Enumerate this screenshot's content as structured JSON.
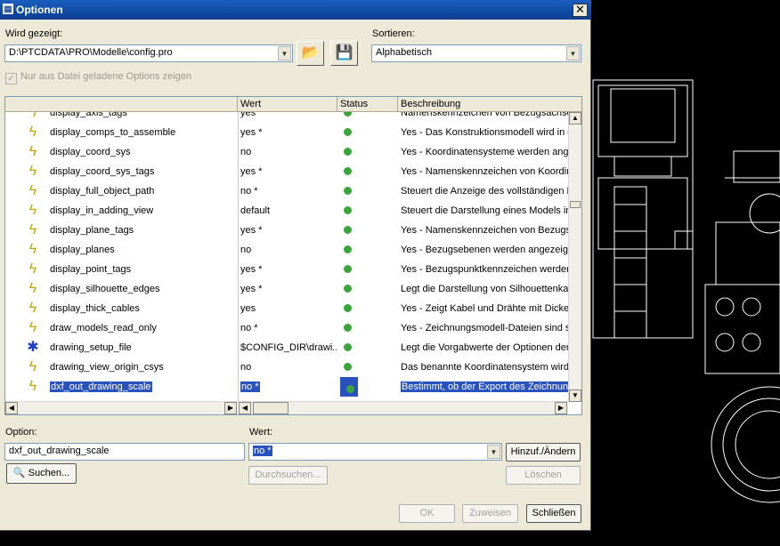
{
  "window": {
    "title": "Optionen",
    "close_glyph": "✕",
    "icon": "ptc-app-icon"
  },
  "shown_label": "Wird gezeigt:",
  "shown_value": "D:\\PTCDATA\\PRO\\Modelle\\config.pro",
  "sort_label": "Sortieren:",
  "sort_value": "Alphabetisch",
  "only_file_options_label": "Nur aus Datei geladene Options zeigen",
  "columns": {
    "name": "",
    "value": "Wert",
    "status": "Status",
    "description": "Beschreibung"
  },
  "rows": [
    {
      "name": "display_axis_tags",
      "value": "yes",
      "desc": "Namenskennzeichen von Bezugsachse",
      "icon": "lightning-icon"
    },
    {
      "name": "display_comps_to_assemble",
      "value": "yes *",
      "desc": "Yes - Das Konstruktionsmodell wird in de",
      "icon": "lightning-icon"
    },
    {
      "name": "display_coord_sys",
      "value": "no",
      "desc": "Yes - Koordinatensysteme werden ange",
      "icon": "lightning-icon"
    },
    {
      "name": "display_coord_sys_tags",
      "value": "yes *",
      "desc": "Yes - Namenskennzeichen von Koordin",
      "icon": "lightning-icon"
    },
    {
      "name": "display_full_object_path",
      "value": "no *",
      "desc": "Steuert die Anzeige des vollständigen D",
      "icon": "lightning-icon"
    },
    {
      "name": "display_in_adding_view",
      "value": "default",
      "desc": "Steuert die Darstellung eines Models in",
      "icon": "lightning-icon"
    },
    {
      "name": "display_plane_tags",
      "value": "yes *",
      "desc": "Yes - Namenskennzeichen von Bezugs",
      "icon": "lightning-icon"
    },
    {
      "name": "display_planes",
      "value": "no",
      "desc": "Yes - Bezugsebenen werden angezeigt.",
      "icon": "lightning-icon"
    },
    {
      "name": "display_point_tags",
      "value": "yes *",
      "desc": "Yes - Bezugspunktkennzeichen werden",
      "icon": "lightning-icon"
    },
    {
      "name": "display_silhouette_edges",
      "value": "yes *",
      "desc": "Legt die Darstellung von Silhouettenkan",
      "icon": "lightning-icon"
    },
    {
      "name": "display_thick_cables",
      "value": "yes",
      "desc": "Yes - Zeigt Kabel und Drähte mit Dicke",
      "icon": "lightning-icon"
    },
    {
      "name": "draw_models_read_only",
      "value": "no *",
      "desc": "Yes - Zeichnungsmodell-Dateien sind sc",
      "icon": "lightning-icon"
    },
    {
      "name": "drawing_setup_file",
      "value": "$CONFIG_DIR\\drawi...",
      "desc": "Legt die Vorgabwerte der Optionen der Z",
      "icon": "asterisk-icon"
    },
    {
      "name": "drawing_view_origin_csys",
      "value": "no",
      "desc": "Das benannte Koordinatensystem wird a",
      "icon": "lightning-icon"
    },
    {
      "name": "dxf_out_drawing_scale",
      "value": "no *",
      "desc": "Bestimmt, ob der Export des Zeichnung-",
      "icon": "lightning-icon",
      "selected": true
    }
  ],
  "option_label": "Option:",
  "option_value": "dxf_out_drawing_scale",
  "value_label": "Wert:",
  "value_value": "no *",
  "add_change_label": "Hinzuf./Ändern",
  "search_label": "Suchen...",
  "browse_label": "Durchsuchen...",
  "delete_label": "Löschen",
  "ok_label": "OK",
  "apply_label": "Zuweisen",
  "close_label": "Schließen",
  "colors": {
    "selection": "#2a52be",
    "status_dot": "#39a53a",
    "title_bar": "#0a3d91"
  }
}
